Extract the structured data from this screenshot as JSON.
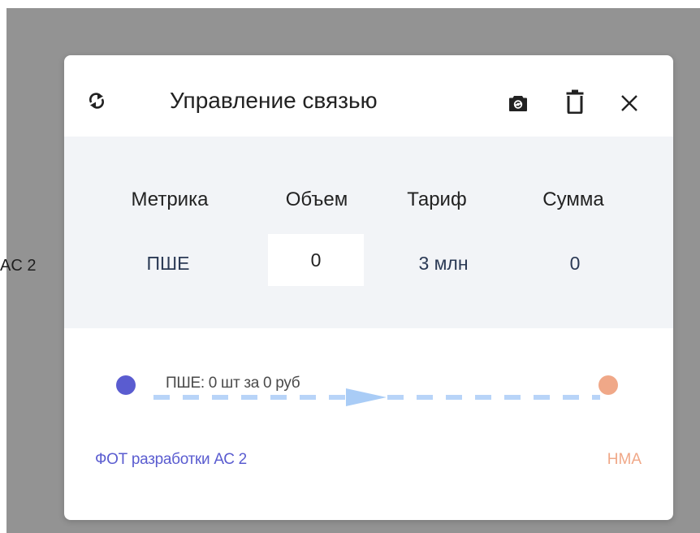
{
  "background": {
    "node_label_fragment": "AC 2"
  },
  "modal": {
    "title": "Управление связью",
    "table": {
      "headers": [
        "Метрика",
        "Объем",
        "Тариф",
        "Сумма"
      ],
      "row": {
        "metric": "ПШЕ",
        "volume": "0",
        "tariff": "3 млн",
        "sum": "0"
      }
    },
    "flow": {
      "label": "ПШЕ: 0 шт за 0 руб",
      "source": {
        "name": "ФОТ разработки АС 2",
        "color": "#5a5cd0"
      },
      "target": {
        "name": "НМА",
        "color": "#f0a888"
      },
      "line_color": "#b8d4f8",
      "arrow_color": "#a9ccf6"
    }
  },
  "icons": {
    "refresh": "refresh-icon",
    "camera": "camera-icon",
    "trash": "trash-icon",
    "close": "close-icon"
  },
  "colors": {
    "backdrop": "#939393",
    "panel": "#f2f4f7",
    "header_text": "#222222"
  }
}
